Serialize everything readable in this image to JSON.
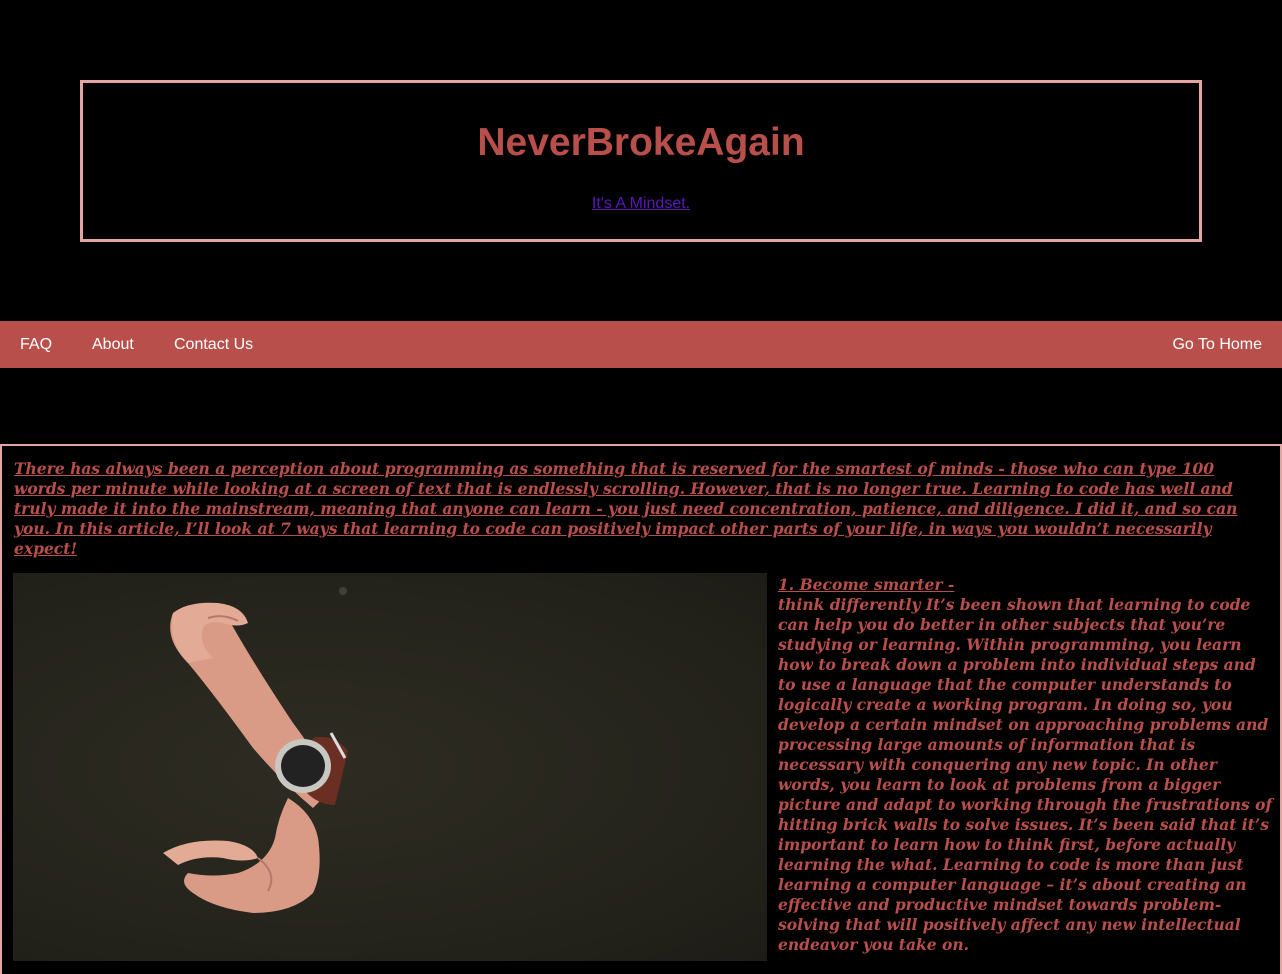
{
  "header": {
    "title": "NeverBrokeAgain",
    "tagline": "It's A Mindset."
  },
  "nav": {
    "faq": "FAQ",
    "about": "About",
    "contact": "Contact Us",
    "home": "Go To Home"
  },
  "content": {
    "intro": "There has always been a perception about programming as something that is reserved for the smartest of minds - those who can type 100 words per minute while looking at a screen of text that is endlessly scrolling. However, that is no longer true. Learning to code has well and truly made it into the mainstream, meaning that anyone can learn - you just need concentration, patience, and diligence. I did it, and so can you. In this article, I’ll look at 7 ways that learning to code can positively impact other parts of your life, in ways you wouldn’t necessarily expect!",
    "section_heading": "1. Become smarter -",
    "section_body": "think differently It’s been shown that learning to code can help you do better in other subjects that you’re studying or learning. Within programming, you learn how to break down a problem into individual steps and to use a language that the computer understands to logically create a working program. In doing so, you develop a certain mindset on approaching problems and processing large amounts of information that is necessary with conquering any new topic. In other words, you learn to look at problems from a bigger picture and adapt to working through the frustrations of hitting brick walls to solve issues. It’s been said that it’s important to learn how to think first, before actually learning the what. Learning to code is more than just learning a computer language – it’s about creating an effective and productive mindset towards problem-solving that will positively affect any new intellectual endeavor you take on.",
    "photo_icon": "wristwatch-photo"
  },
  "colors": {
    "accent": "#b84f4b",
    "border": "#e3a4a4",
    "link": "#5a18b8",
    "background": "#000000"
  }
}
